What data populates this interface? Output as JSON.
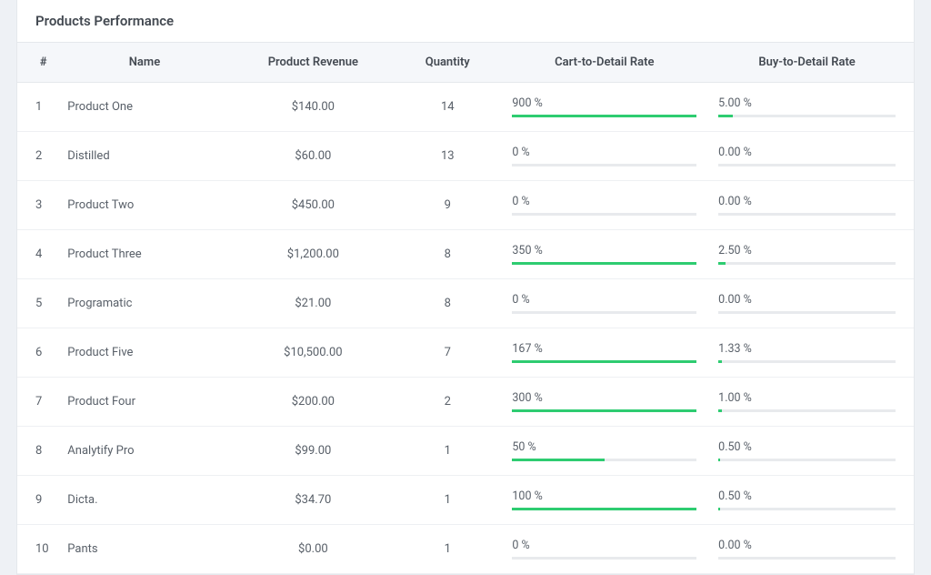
{
  "title": "Products Performance",
  "columns": {
    "num": "#",
    "name": "Name",
    "revenue": "Product Revenue",
    "quantity": "Quantity",
    "cart_rate": "Cart-to-Detail Rate",
    "buy_rate": "Buy-to-Detail Rate"
  },
  "rows": [
    {
      "num": "1",
      "name": "Product One",
      "revenue": "$140.00",
      "quantity": "14",
      "cart_rate": "900 %",
      "cart_fill": 100,
      "buy_rate": "5.00 %",
      "buy_fill": 8
    },
    {
      "num": "2",
      "name": "Distilled",
      "revenue": "$60.00",
      "quantity": "13",
      "cart_rate": "0 %",
      "cart_fill": 0,
      "buy_rate": "0.00 %",
      "buy_fill": 0
    },
    {
      "num": "3",
      "name": "Product Two",
      "revenue": "$450.00",
      "quantity": "9",
      "cart_rate": "0 %",
      "cart_fill": 0,
      "buy_rate": "0.00 %",
      "buy_fill": 0
    },
    {
      "num": "4",
      "name": "Product Three",
      "revenue": "$1,200.00",
      "quantity": "8",
      "cart_rate": "350 %",
      "cart_fill": 100,
      "buy_rate": "2.50 %",
      "buy_fill": 4
    },
    {
      "num": "5",
      "name": "Programatic",
      "revenue": "$21.00",
      "quantity": "8",
      "cart_rate": "0 %",
      "cart_fill": 0,
      "buy_rate": "0.00 %",
      "buy_fill": 0
    },
    {
      "num": "6",
      "name": "Product Five",
      "revenue": "$10,500.00",
      "quantity": "7",
      "cart_rate": "167 %",
      "cart_fill": 100,
      "buy_rate": "1.33 %",
      "buy_fill": 2
    },
    {
      "num": "7",
      "name": "Product Four",
      "revenue": "$200.00",
      "quantity": "2",
      "cart_rate": "300 %",
      "cart_fill": 100,
      "buy_rate": "1.00 %",
      "buy_fill": 2
    },
    {
      "num": "8",
      "name": "Analytify Pro",
      "revenue": "$99.00",
      "quantity": "1",
      "cart_rate": "50 %",
      "cart_fill": 50,
      "buy_rate": "0.50 %",
      "buy_fill": 1
    },
    {
      "num": "9",
      "name": "Dicta.",
      "revenue": "$34.70",
      "quantity": "1",
      "cart_rate": "100 %",
      "cart_fill": 100,
      "buy_rate": "0.50 %",
      "buy_fill": 1
    },
    {
      "num": "10",
      "name": "Pants",
      "revenue": "$0.00",
      "quantity": "1",
      "cart_rate": "0 %",
      "cart_fill": 0,
      "buy_rate": "0.00 %",
      "buy_fill": 0
    }
  ]
}
